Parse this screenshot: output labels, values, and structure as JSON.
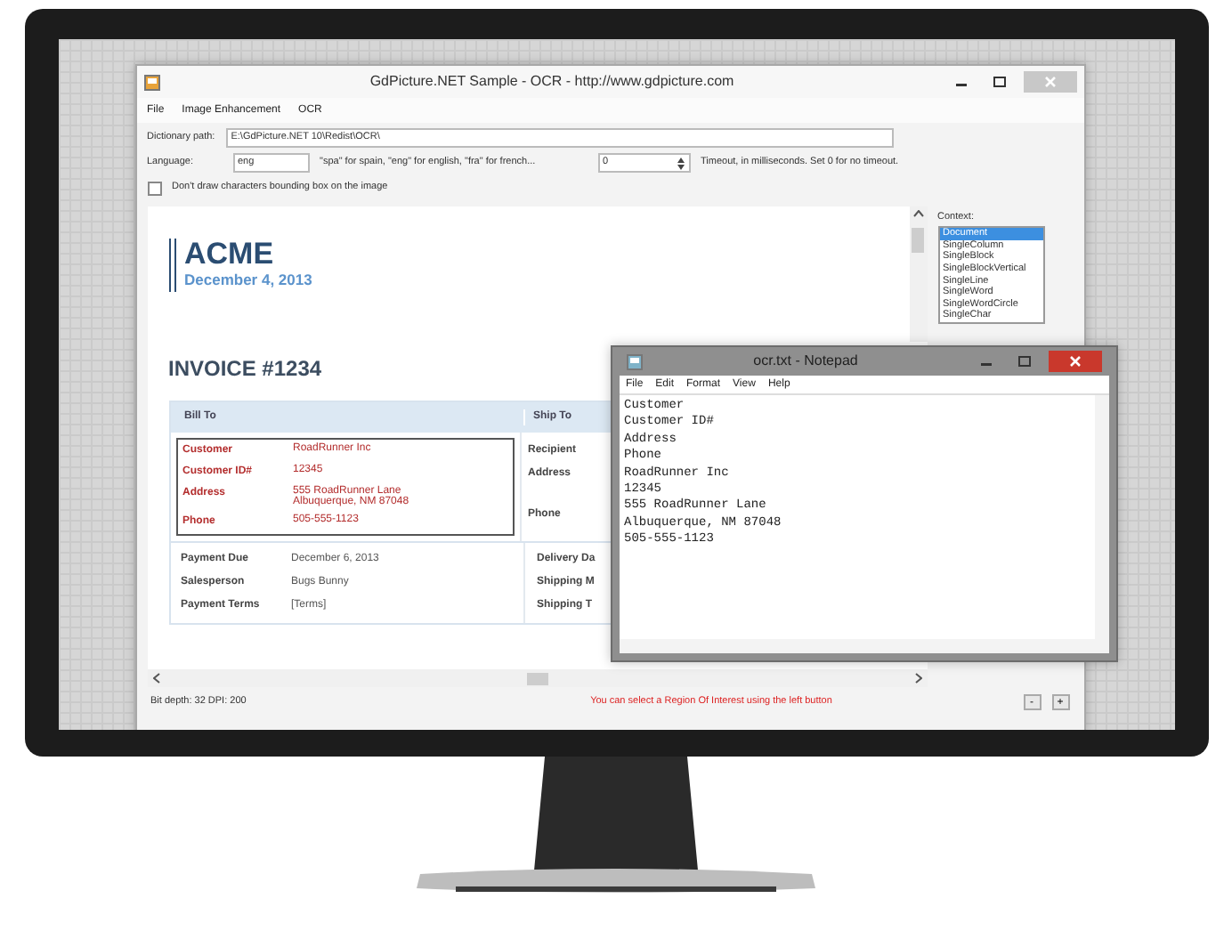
{
  "main_window": {
    "title": "GdPicture.NET Sample - OCR - http://www.gdpicture.com",
    "menu": [
      "File",
      "Image Enhancement",
      "OCR"
    ],
    "dictionary": {
      "label": "Dictionary path:",
      "value": "E:\\GdPicture.NET 10\\Redist\\OCR\\"
    },
    "language": {
      "label": "Language:",
      "value": "eng",
      "hint": "\"spa\" for spain, \"eng\" for english, \"fra\" for french...",
      "timeout_value": "0",
      "timeout_hint": "Timeout, in milliseconds. Set 0 for no timeout."
    },
    "bounding_box_option": {
      "label": "Don't draw characters bounding box on the image",
      "checked": false
    },
    "document": {
      "company": "ACME",
      "date": "December 4, 2013",
      "invoice": "INVOICE #1234",
      "bill_to": {
        "heading": "Bill To",
        "rows": [
          {
            "label": "Customer",
            "value": "RoadRunner Inc"
          },
          {
            "label": "Customer ID#",
            "value": "12345"
          },
          {
            "label": "Address",
            "value": "555 RoadRunner Lane\nAlbuquerque, NM 87048"
          },
          {
            "label": "Phone",
            "value": "505-555-1123"
          }
        ]
      },
      "ship_to": {
        "heading": "Ship To",
        "labels": [
          "Recipient",
          "Address",
          "Phone"
        ]
      },
      "details": [
        {
          "label": "Payment Due",
          "value": "December 6, 2013"
        },
        {
          "label": "Salesperson",
          "value": "Bugs Bunny"
        },
        {
          "label": "Payment Terms",
          "value": "[Terms]"
        }
      ],
      "ship_details": [
        "Delivery Da",
        "Shipping M",
        "Shipping T"
      ]
    },
    "context": {
      "label": "Context:",
      "items": [
        {
          "label": "Document",
          "selected": true
        },
        {
          "label": "SingleColumn",
          "selected": false
        },
        {
          "label": "SingleBlock",
          "selected": false
        },
        {
          "label": "SingleBlockVertical",
          "selected": false
        },
        {
          "label": "SingleLine",
          "selected": false
        },
        {
          "label": "SingleWord",
          "selected": false
        },
        {
          "label": "SingleWordCircle",
          "selected": false
        },
        {
          "label": "SingleChar",
          "selected": false
        }
      ]
    },
    "status_bar": {
      "info": "Bit depth:  32 DPI:  200",
      "message": "You can select a Region Of Interest using the left button",
      "buttons": [
        "-",
        "+"
      ]
    }
  },
  "notepad": {
    "title": "ocr.txt - Notepad",
    "menu": [
      "File",
      "Edit",
      "Format",
      "View",
      "Help"
    ],
    "lines": [
      "Customer",
      "Customer ID#",
      "Address",
      "Phone",
      "RoadRunner Inc",
      "12345",
      "555 RoadRunner Lane",
      "Albuquerque, NM 87048",
      "505-555-1123"
    ]
  }
}
